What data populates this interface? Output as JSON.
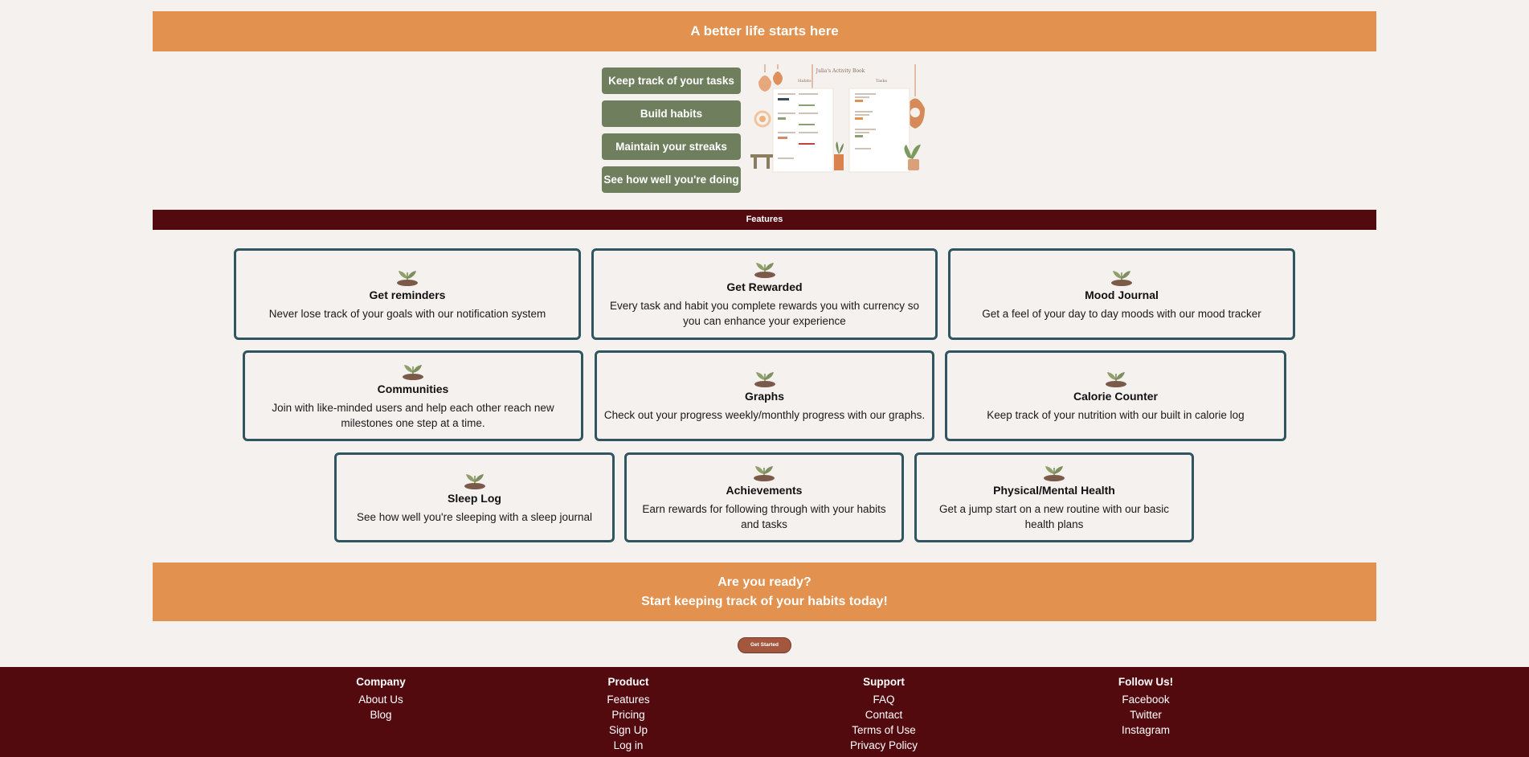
{
  "banner": {
    "title": "A better life starts here"
  },
  "hero": {
    "buttons": [
      "Keep track of your tasks",
      "Build habits",
      "Maintain your streaks",
      "See how well you're doing"
    ],
    "image": {
      "book_title": "Julia's Activity Book",
      "habits_label": "Habits",
      "tasks_label": "Tasks"
    }
  },
  "features": {
    "heading": "Features",
    "cards": [
      {
        "title": "Get reminders",
        "desc": "Never lose track of your goals with our notification system"
      },
      {
        "title": "Get Rewarded",
        "desc": "Every task and habit you complete rewards you with currency so you can enhance your experience"
      },
      {
        "title": "Mood Journal",
        "desc": "Get a feel of your day to day moods with our mood tracker"
      },
      {
        "title": "Communities",
        "desc": "Join with like-minded users and help each other reach new milestones one step at a time."
      },
      {
        "title": "Graphs",
        "desc": "Check out your progress weekly/monthly progress with our graphs."
      },
      {
        "title": "Calorie Counter",
        "desc": "Keep track of your nutrition with our built in calorie log"
      },
      {
        "title": "Sleep Log",
        "desc": "See how well you're sleeping with a sleep journal"
      },
      {
        "title": "Achievements",
        "desc": "Earn rewards for following through with your habits and tasks"
      },
      {
        "title": "Physical/Mental Health",
        "desc": "Get a jump start on a new routine with our basic health plans"
      }
    ]
  },
  "cta": {
    "line1": "Are you ready?",
    "line2": "Start keeping track of your habits today!",
    "button": "Get Started"
  },
  "footer": {
    "columns": [
      {
        "heading": "Company",
        "links": [
          "About Us",
          "Blog"
        ]
      },
      {
        "heading": "Product",
        "links": [
          "Features",
          "Pricing",
          "Sign Up",
          "Log in"
        ]
      },
      {
        "heading": "Support",
        "links": [
          "FAQ",
          "Contact",
          "Terms of Use",
          "Privacy Policy"
        ]
      },
      {
        "heading": "Follow Us!",
        "links": [
          "Facebook",
          "Twitter",
          "Instagram"
        ]
      }
    ]
  },
  "colors": {
    "orange": "#e2914f",
    "maroon": "#530a0f",
    "green": "#6f7f5e",
    "card_border": "#2e5560",
    "background": "#f5f1ee"
  }
}
